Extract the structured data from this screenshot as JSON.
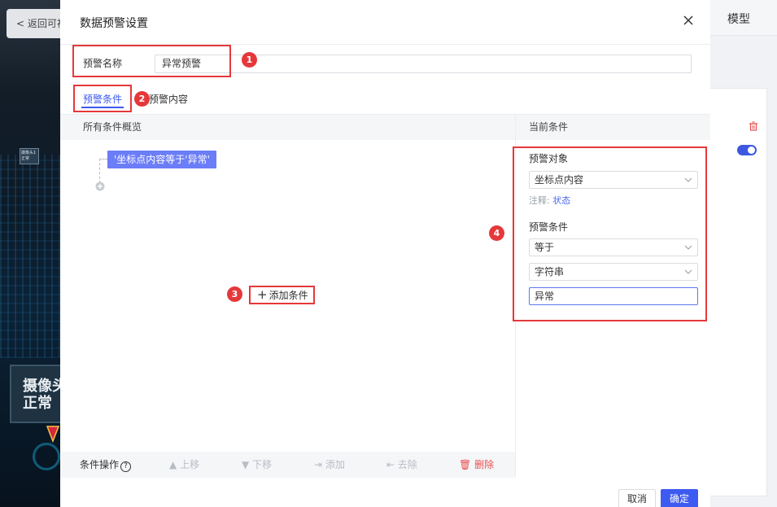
{
  "background": {
    "back_button": "返回可视",
    "model_tab": "模型",
    "camera_small": "摄像头1 正常",
    "camera_big_line1": "摄像头",
    "camera_big_line2": "正常"
  },
  "dialog": {
    "title": "数据预警设置",
    "name_label": "预警名称",
    "name_value": "异常预警",
    "tabs": [
      "预警条件",
      "预警内容"
    ],
    "active_tab": "预警条件"
  },
  "overview": {
    "header": "所有条件概览",
    "condition_chip": "'坐标点内容等于'异常'",
    "add_condition": "添加条件"
  },
  "operations": {
    "label": "条件操作",
    "move_up": "上移",
    "move_down": "下移",
    "add": "添加",
    "remove": "去除",
    "delete": "删除"
  },
  "current_condition": {
    "header": "当前条件",
    "target_label": "预警对象",
    "target_value": "坐标点内容",
    "note_prefix": "注释:",
    "note_value": "状态",
    "condition_label": "预警条件",
    "operator_value": "等于",
    "type_value": "字符串",
    "value": "异常"
  },
  "footer": {
    "cancel": "取消",
    "confirm": "确定"
  },
  "annotations": [
    "1",
    "2",
    "3",
    "4"
  ],
  "colors": {
    "accent": "#3d5af1",
    "chip": "#6b7df7",
    "annotation": "#e5383b",
    "delete": "#e94f4f"
  }
}
